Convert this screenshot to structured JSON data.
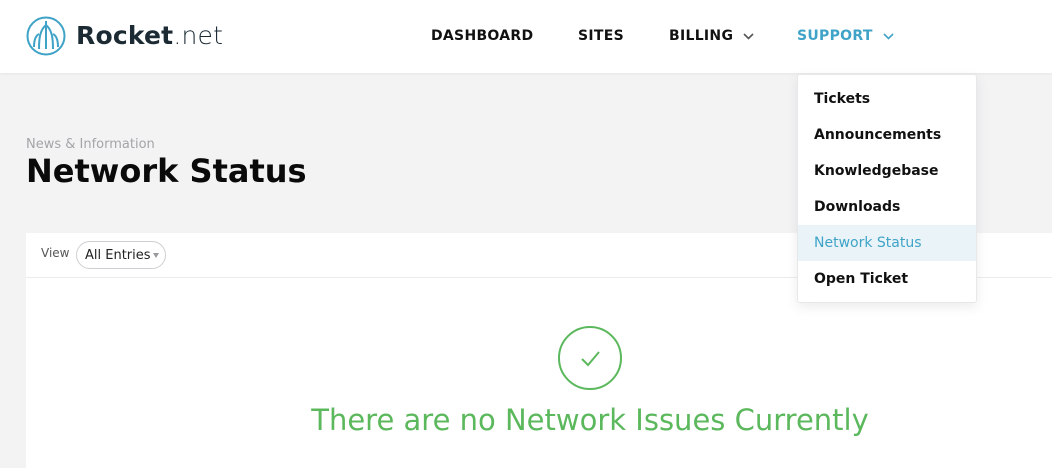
{
  "brand": {
    "name_bold": "Rocket",
    "name_light": ".net",
    "accent_color": "#3fa3c7"
  },
  "nav": {
    "dashboard": "DASHBOARD",
    "sites": "SITES",
    "billing": "BILLING",
    "support": "SUPPORT"
  },
  "support_menu": {
    "items": [
      {
        "label": "Tickets"
      },
      {
        "label": "Announcements"
      },
      {
        "label": "Knowledgebase"
      },
      {
        "label": "Downloads"
      },
      {
        "label": "Network Status",
        "active": true
      },
      {
        "label": "Open Ticket"
      }
    ]
  },
  "page": {
    "eyebrow": "News & Information",
    "title": "Network Status"
  },
  "filter": {
    "view_label": "View",
    "selected": "All Entries"
  },
  "status": {
    "message": "There are no Network Issues Currently",
    "color": "#5cb85c",
    "icon": "check-circle-icon"
  }
}
